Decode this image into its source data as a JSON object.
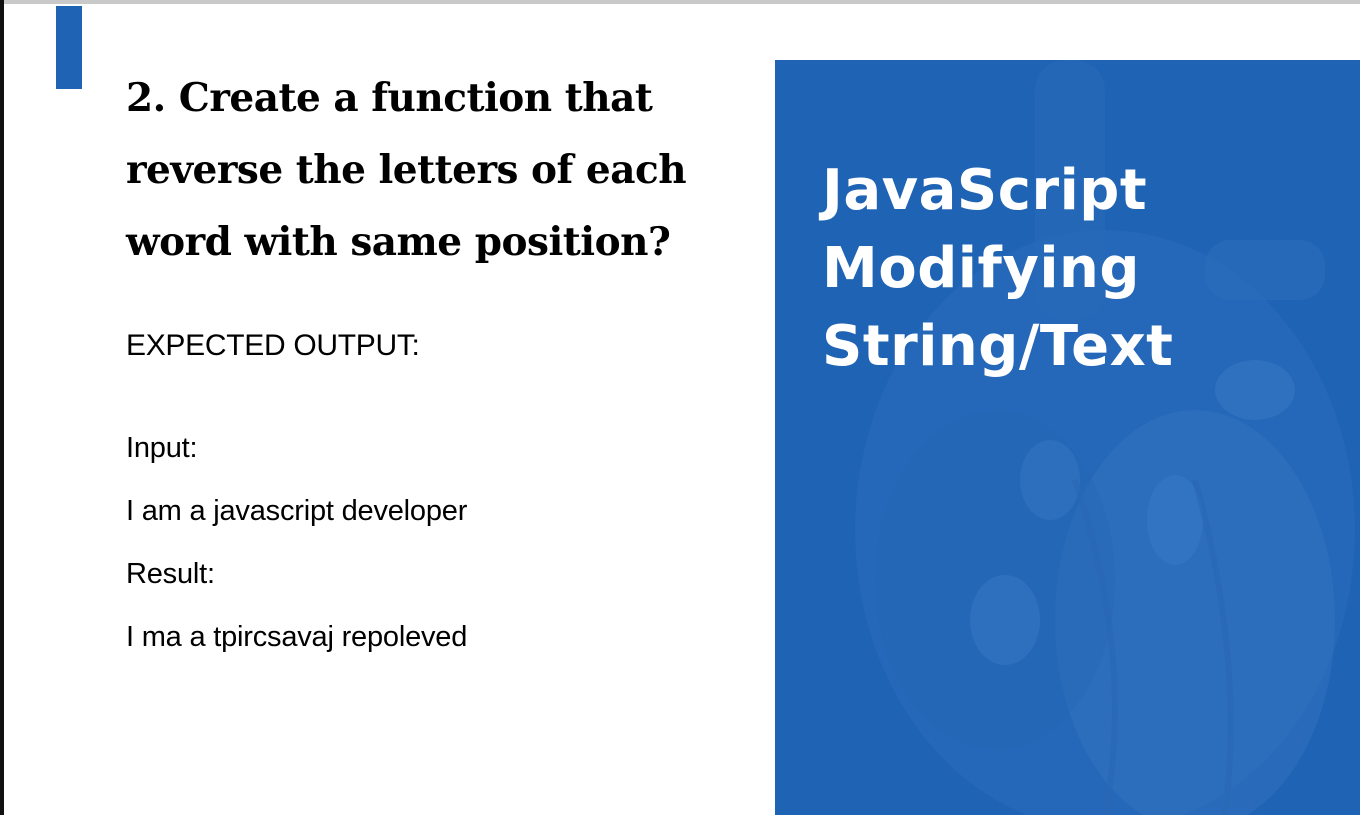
{
  "slide": {
    "question_lines": [
      "2. Create a function that",
      "reverse the letters of each",
      "word with same position?"
    ],
    "expected_label": "EXPECTED OUTPUT:",
    "input_label": "Input:",
    "input_value": "I am a javascript developer",
    "result_label": "Result:",
    "result_value": "I ma a tpircsavaj repoleved"
  },
  "side_panel": {
    "title_lines": [
      "JavaScript",
      "Modifying",
      "String/Text"
    ]
  },
  "colors": {
    "accent": "#1f63b4",
    "text": "#000000",
    "panel_text": "#ffffff"
  }
}
